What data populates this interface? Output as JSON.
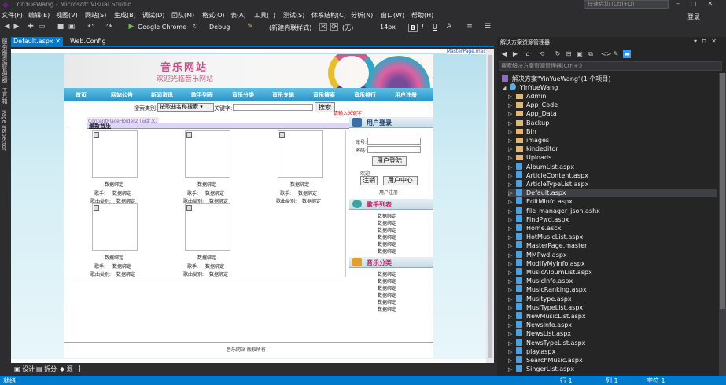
{
  "title_bar": {
    "app_title": "YinYueWang - Microsoft Visual Studio",
    "quick_launch_placeholder": "快速启动 (Ctrl+Q)",
    "login": "登录"
  },
  "menu": [
    "文件(F)",
    "编辑(E)",
    "视图(V)",
    "网站(S)",
    "生成(B)",
    "调试(D)",
    "团队(M)",
    "格式(O)",
    "表(A)",
    "工具(T)",
    "测试(S)",
    "体系结构(C)",
    "分析(N)",
    "窗口(W)",
    "帮助(H)"
  ],
  "toolbar": {
    "browser": "Google Chrome",
    "config": "Debug",
    "style": "(新建内联样式)",
    "target": "(无)",
    "font_size": "14px",
    "bold": "B",
    "italic": "I",
    "underline": "U"
  },
  "left_strip": [
    "服务器资源管理器",
    "工具箱",
    "Page Inspector"
  ],
  "doc_tabs": [
    "Default.aspx",
    "Web.Config"
  ],
  "designer": {
    "master_badge": "MasterPage.master",
    "site": {
      "title": "音乐网站",
      "subtitle": "欢迎光临音乐网站",
      "nav": [
        "首页",
        "网站公告",
        "新闻资讯",
        "歌手列表",
        "音乐分类",
        "音乐专辑",
        "音乐搜索",
        "音乐排行",
        "用户注册"
      ],
      "search_label": "搜索类别:",
      "search_select": "按歌曲名称搜索",
      "keyword_label": "关键字:",
      "search_button": "搜索",
      "required_hint": "请输入关键字",
      "placeholder_label": "ContentPlaceHolder2 (自定义)",
      "content_title": "最新音乐",
      "items": [
        {
          "bind": "数据绑定",
          "singer_label": "歌手:",
          "singer": "数据绑定",
          "cat_label": "歌曲类别:",
          "cat": "数据绑定"
        },
        {
          "bind": "数据绑定",
          "singer_label": "歌手:",
          "singer": "数据绑定",
          "cat_label": "歌曲类别:",
          "cat": "数据绑定"
        },
        {
          "bind": "数据绑定",
          "singer_label": "歌手:",
          "singer": "数据绑定",
          "cat_label": "歌曲类别:",
          "cat": "数据绑定"
        },
        {
          "bind": "数据绑定",
          "singer_label": "歌手:",
          "singer": "数据绑定",
          "cat_label": "歌曲类别:",
          "cat": "数据绑定"
        },
        {
          "bind": "数据绑定",
          "singer_label": "歌手:",
          "singer": "数据绑定",
          "cat_label": "歌曲类别:",
          "cat": "数据绑定"
        }
      ],
      "login_box": {
        "title": "用户登录",
        "account_label": "账号:",
        "password_label": "密码:",
        "login_button": "用户登陆",
        "welcome": "欢迎",
        "logout_button": "注销",
        "center_button": "用户中心",
        "register": "用户注册"
      },
      "singers_box": {
        "title": "歌手列表",
        "items": [
          "数据绑定",
          "数据绑定",
          "数据绑定",
          "数据绑定",
          "数据绑定",
          "数据绑定"
        ]
      },
      "categories_box": {
        "title": "音乐分类",
        "items": [
          "数据绑定",
          "数据绑定",
          "数据绑定",
          "数据绑定",
          "数据绑定",
          "数据绑定"
        ]
      },
      "footer": "音乐网站 版权所有"
    }
  },
  "view_bar": [
    "设计",
    "拆分",
    "源"
  ],
  "status_bar": {
    "ready": "就绪",
    "line": "行 1",
    "col": "列 1",
    "ch": "字符 1"
  },
  "solution_explorer": {
    "title": "解决方案资源管理器",
    "search_placeholder": "搜索解决方案资源管理器(Ctrl+;)",
    "solution": "解决方案\"YinYueWang\"(1 个项目)",
    "project": "YinYueWang",
    "items": [
      {
        "name": "Admin",
        "type": "folder"
      },
      {
        "name": "App_Code",
        "type": "folder"
      },
      {
        "name": "App_Data",
        "type": "folder"
      },
      {
        "name": "Backup",
        "type": "folder"
      },
      {
        "name": "Bin",
        "type": "folder"
      },
      {
        "name": "images",
        "type": "folder"
      },
      {
        "name": "kindeditor",
        "type": "folder"
      },
      {
        "name": "Uploads",
        "type": "folder"
      },
      {
        "name": "AlbumList.aspx",
        "type": "file"
      },
      {
        "name": "ArticleContent.aspx",
        "type": "file"
      },
      {
        "name": "ArticleTypeList.aspx",
        "type": "file"
      },
      {
        "name": "Default.aspx",
        "type": "file",
        "selected": true
      },
      {
        "name": "EditMInfo.aspx",
        "type": "file"
      },
      {
        "name": "file_manager_json.ashx",
        "type": "file"
      },
      {
        "name": "FindPwd.aspx",
        "type": "file"
      },
      {
        "name": "Home.ascx",
        "type": "file"
      },
      {
        "name": "HotMusicList.aspx",
        "type": "file"
      },
      {
        "name": "MasterPage.master",
        "type": "file"
      },
      {
        "name": "MMPwd.aspx",
        "type": "file"
      },
      {
        "name": "ModifyMyInfo.aspx",
        "type": "file"
      },
      {
        "name": "MusicAlbumList.aspx",
        "type": "file"
      },
      {
        "name": "MusicInfo.aspx",
        "type": "file"
      },
      {
        "name": "MusicRanking.aspx",
        "type": "file"
      },
      {
        "name": "Musitype.aspx",
        "type": "file"
      },
      {
        "name": "MusiTypeList.aspx",
        "type": "file"
      },
      {
        "name": "NewMusicList.aspx",
        "type": "file"
      },
      {
        "name": "NewsInfo.aspx",
        "type": "file"
      },
      {
        "name": "NewsList.aspx",
        "type": "file"
      },
      {
        "name": "NewsTypeList.aspx",
        "type": "file"
      },
      {
        "name": "play.aspx",
        "type": "file"
      },
      {
        "name": "SearchMusic.aspx",
        "type": "file"
      },
      {
        "name": "SingerList.aspx",
        "type": "file"
      }
    ]
  }
}
